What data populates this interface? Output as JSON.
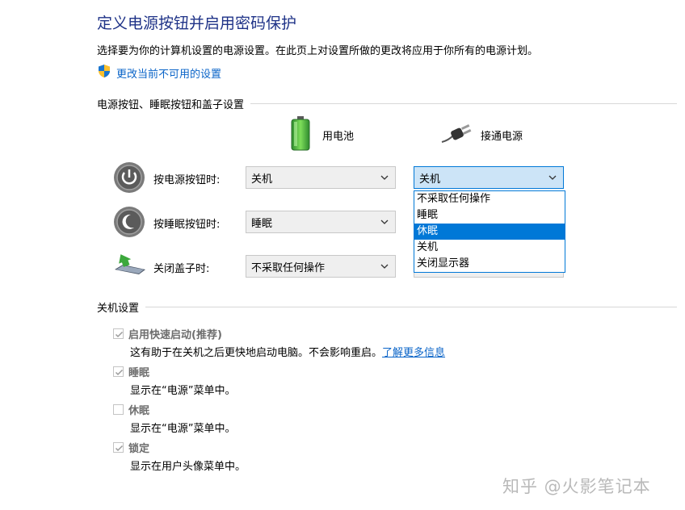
{
  "header": {
    "title": "定义电源按钮并启用密码保护",
    "description": "选择要为你的计算机设置的电源设置。在此页上对设置所做的更改将应用于你所有的电源计划。",
    "change_link": "更改当前不可用的设置"
  },
  "power_buttons_section": {
    "heading": "电源按钮、睡眠按钮和盖子设置",
    "columns": {
      "battery": "用电池",
      "plugged_in": "接通电源"
    },
    "rows": [
      {
        "label": "按电源按钮时:",
        "battery_value": "关机",
        "plugged_value": "关机",
        "icon": "power-button-icon"
      },
      {
        "label": "按睡眠按钮时:",
        "battery_value": "睡眠",
        "plugged_value": "",
        "icon": "sleep-button-icon"
      },
      {
        "label": "关闭盖子时:",
        "battery_value": "不采取任何操作",
        "plugged_value": "",
        "icon": "laptop-lid-icon"
      }
    ],
    "open_dropdown": {
      "options": [
        "不采取任何操作",
        "睡眠",
        "休眠",
        "关机",
        "关闭显示器"
      ],
      "highlighted": "休眠"
    }
  },
  "shutdown_section": {
    "heading": "关机设置",
    "items": [
      {
        "label": "启用快速启动(推荐)",
        "checked": true,
        "desc": "这有助于在关机之后更快地启动电脑。不会影响重启。",
        "link": "了解更多信息"
      },
      {
        "label": "睡眠",
        "checked": true,
        "desc": "显示在“电源”菜单中。"
      },
      {
        "label": "休眠",
        "checked": false,
        "desc": "显示在“电源”菜单中。"
      },
      {
        "label": "锁定",
        "checked": true,
        "desc": "显示在用户头像菜单中。"
      }
    ]
  },
  "watermark": "知乎 @火影笔记本",
  "colors": {
    "title": "#1e3287",
    "link": "#0a64c8",
    "selection": "#0078d7"
  }
}
